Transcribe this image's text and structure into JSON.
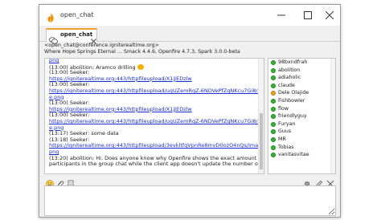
{
  "window": {
    "title": "open_chat"
  },
  "tab": {
    "label": "open_chat"
  },
  "room": {
    "jid": "<open_chat@conference.igniterealtime.org>",
    "subject": "Where Hope Springs Eternal ... Smack 4.4.6, Openfire 4.7.3, Spark 3.0.0-beta"
  },
  "messages": [
    {
      "text": "png",
      "link": true
    },
    {
      "text": "(13:00) abolition: Aramco drilling",
      "emoji": true
    },
    {
      "text": "(13:00) Seeker:"
    },
    {
      "text": "https://igniterealtime.org:443/httpfileupload/X1jJEDzlw",
      "link": true
    },
    {
      "text": "(13:00) Seeker:"
    },
    {
      "text": "https://igniterealtime.org:443/httpfileupload/ugUZemRqZ-6NDVePfZqNKcu7Gi8/imag",
      "link": true
    },
    {
      "text": "e.png",
      "link": true
    },
    {
      "text": "(13:00) Seeker:"
    },
    {
      "text": "https://igniterealtime.org:443/httpfileupload/X1jJEDzlw",
      "link": true
    },
    {
      "text": "(13:00) Seeker:"
    },
    {
      "text": "https://igniterealtime.org:443/httpfileupload/ugUZemRqZ-6NDVePfZqNKcu7Gi8/imag",
      "link": true
    },
    {
      "text": "e.png",
      "link": true
    },
    {
      "text": "(13:17) Seeker: some data"
    },
    {
      "text": "(13:18) Seeker:"
    },
    {
      "text": "https://igniterealtime.org:443/httpfileupload/3evkltfqVpnRe8mvD0ozO4nQs/image",
      "link": true
    },
    {
      "text": "png",
      "link": true
    },
    {
      "text": "(13:20) abolition: Hi. Does anyone know why Openfire shows the exact amount of"
    },
    {
      "text": "participants in the group chat while the client app doesn't update the number of"
    }
  ],
  "occupants": [
    {
      "name": "98bxndfrah",
      "status": "online"
    },
    {
      "name": "abolition",
      "status": "online"
    },
    {
      "name": "adiaholic",
      "status": "online"
    },
    {
      "name": "claude",
      "status": "online"
    },
    {
      "name": "Dele Olajide",
      "status": "away"
    },
    {
      "name": "Fishbowler",
      "status": "online"
    },
    {
      "name": "flow",
      "status": "online"
    },
    {
      "name": "friendlyguy",
      "status": "online"
    },
    {
      "name": "Furyan",
      "status": "online"
    },
    {
      "name": "Guus",
      "status": "online"
    },
    {
      "name": "MR",
      "status": "online"
    },
    {
      "name": "Tobias",
      "status": "online"
    },
    {
      "name": "vanitasvitae",
      "status": "online"
    }
  ],
  "icons": {
    "app": "spark-flame-icon",
    "tab": "chat-bubbles-icon",
    "toolbar_left": [
      "emoji-icon",
      "attach-file-icon",
      "screenshot-icon"
    ],
    "toolbar_right": [
      "settings-gear-icon",
      "edit-pen-icon",
      "kick-icon"
    ]
  },
  "colors": {
    "accent": "#f0a030",
    "link": "#1a2ed6",
    "online": "#2fb52f",
    "away": "#f0a020"
  },
  "compose": {
    "value": ""
  }
}
